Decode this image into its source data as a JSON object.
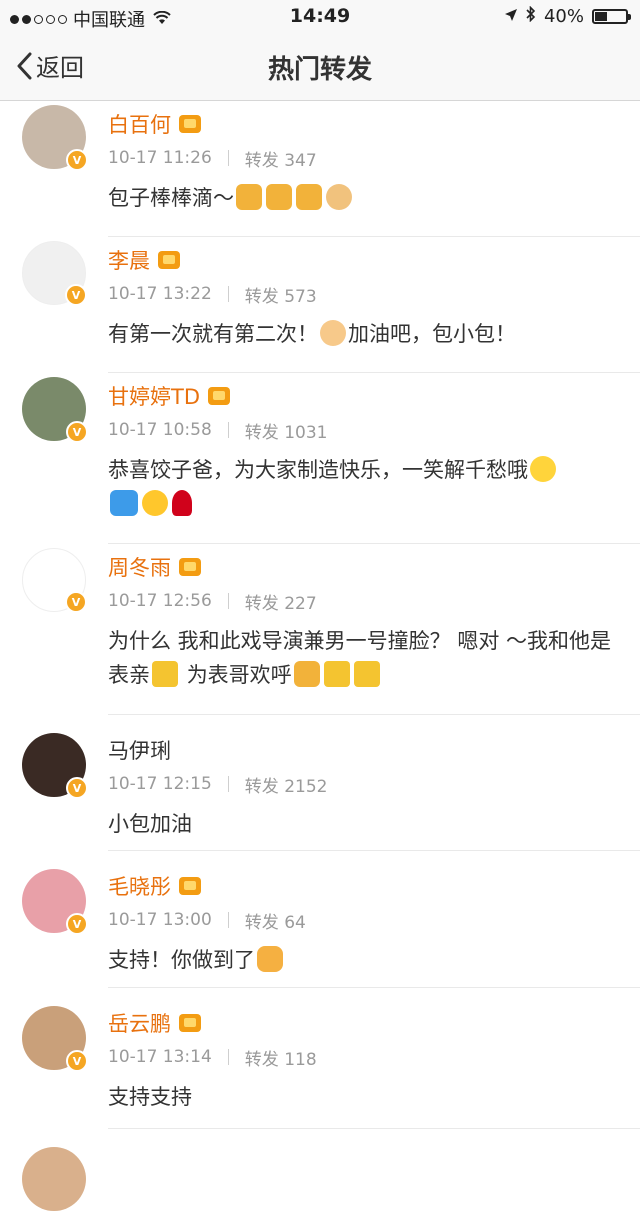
{
  "status": {
    "carrier": "中国联通",
    "time": "14:49",
    "battery": "40%",
    "battery_level": 0.4
  },
  "nav": {
    "back_label": "返回",
    "title": "热门转发"
  },
  "items": [
    {
      "name": "白百何",
      "verified": true,
      "crown": true,
      "time": "10-17 11:26",
      "reposts": "转发 347",
      "text": "包子棒棒滴～",
      "emojis": [
        "beer",
        "beer",
        "beer",
        "fist"
      ],
      "avatar_color": "#c8b8a8"
    },
    {
      "name": "李晨",
      "verified": true,
      "crown": true,
      "time": "10-17 13:22",
      "reposts": "转发 573",
      "text_a": "有第一次就有第二次！",
      "text_b": "加油吧，包小包！",
      "avatar_color": "#f0f0f0"
    },
    {
      "name": "甘婷婷TD",
      "verified": true,
      "crown": true,
      "time": "10-17 10:58",
      "reposts": "转发 1031",
      "text": "恭喜饺子爸，为大家制造快乐，一笑解千愁哦",
      "avatar_color": "#7a8a6a"
    },
    {
      "name": "周冬雨",
      "verified": true,
      "crown": true,
      "time": "10-17 12:56",
      "reposts": "转发 227",
      "text_a": "为什么 我和此戏导演兼男一号撞脸？ 嗯对 ～我和他是表亲",
      "text_b": "为表哥欢呼",
      "avatar_color": "#ffffff"
    },
    {
      "name": "马伊琍",
      "verified": true,
      "crown": false,
      "time": "10-17 12:15",
      "reposts": "转发 2152",
      "text": "小包加油",
      "avatar_color": "#3a2a24"
    },
    {
      "name": "毛晓彤",
      "verified": true,
      "crown": true,
      "time": "10-17 13:00",
      "reposts": "转发 64",
      "text": "支持！你做到了",
      "avatar_color": "#e8a0a8"
    },
    {
      "name": "岳云鹏",
      "verified": true,
      "crown": true,
      "time": "10-17 13:14",
      "reposts": "转发 118",
      "text": "支持支持",
      "avatar_color": "#c9a07a"
    }
  ]
}
